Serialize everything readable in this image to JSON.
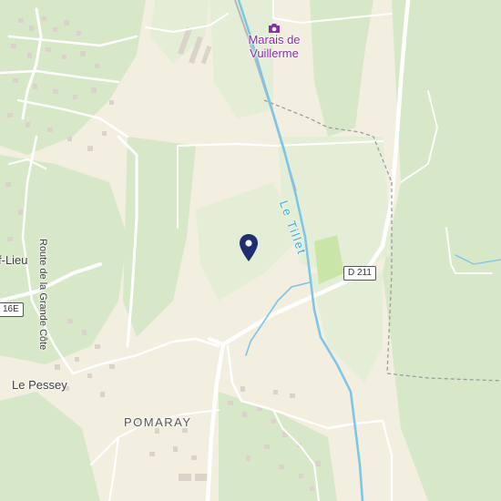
{
  "map": {
    "poi": {
      "label_line1": "Marais de",
      "label_line2": "Vuillerme",
      "icon": "camera-icon",
      "color": "#8a2fa3"
    },
    "river": {
      "name": "Le Tillet",
      "color": "#7cc4e8"
    },
    "road_shields": {
      "d211": "D 211",
      "r16e": "16E"
    },
    "places": {
      "pomaray": "POMARAY",
      "le_pessey": "Le Pessey",
      "partial_left": "f-Lieu",
      "route_grande_cote": "Route de la Grande Côte"
    },
    "marker": {
      "icon": "location-pin-icon",
      "color": "#1f2e6e"
    },
    "colors": {
      "land": "#f2eee0",
      "forest": "#d7e8c9",
      "meadow": "#e4eed7",
      "road": "#ffffff",
      "building": "#d9d3c9",
      "water": "#7cc4e8"
    }
  }
}
